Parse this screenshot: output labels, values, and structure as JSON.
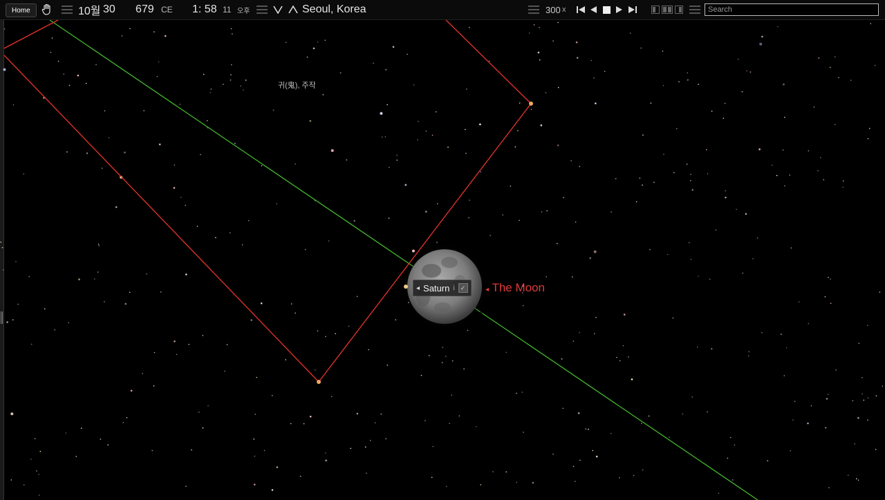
{
  "toolbar": {
    "home_label": "Home",
    "month": "10월",
    "day": "30",
    "year": "679",
    "era": "CE",
    "time_hm": "1: 58",
    "time_sec": "11",
    "ampm": "오후",
    "location": "Seoul, Korea",
    "speed": "300",
    "speed_unit": "x",
    "search_placeholder": "Search"
  },
  "sky": {
    "asterism_label": "귀(鬼), 주작",
    "saturn_label": "Saturn",
    "saturn_info": "i",
    "saturn_check": "✓",
    "moon_label": "The Moon",
    "moon_pointer": "◂",
    "saturn_pointer": "◂"
  },
  "colors": {
    "ecliptic": "#43b82d",
    "asterism_lines": "#e8342d",
    "moon_label": "#e03a3a",
    "background": "#000000"
  }
}
